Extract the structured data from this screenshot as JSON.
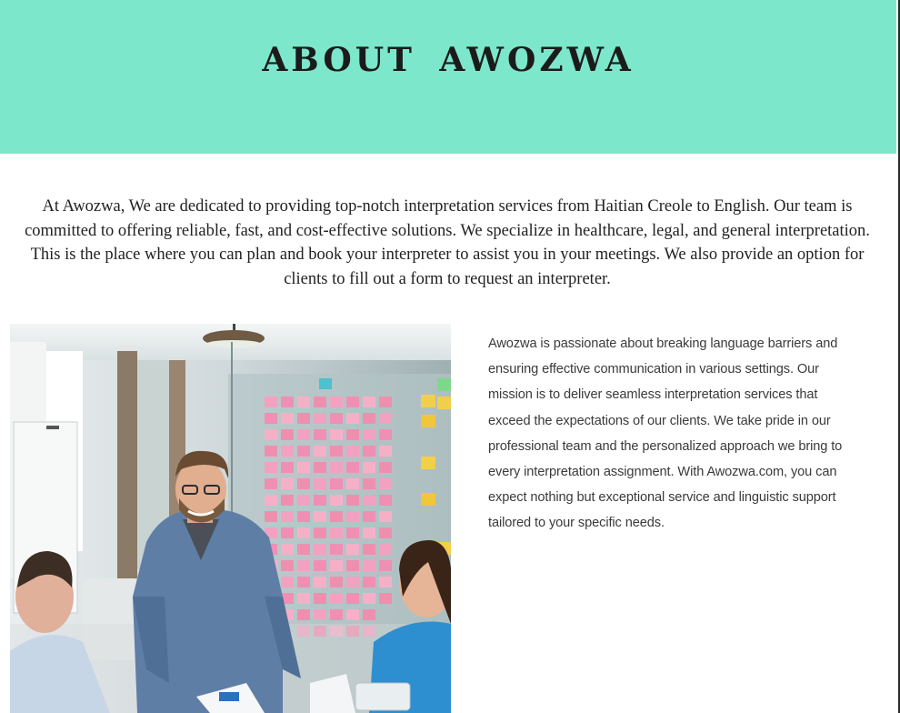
{
  "hero": {
    "title": "ABOUT  AWOZWA",
    "background": "#7de7cc"
  },
  "intro": {
    "text": "At Awozwa, We are dedicated to providing top-notch interpretation services from Haitian Creole to English. Our team is committed to offering reliable, fast, and cost-effective solutions. We specialize in healthcare, legal, and general interpretation. This is the place where you can plan and book your interpreter to assist you in your meetings. We also provide an option for clients to fill out a form to request an interpreter."
  },
  "photo": {
    "subject": "team-meeting-photo"
  },
  "side": {
    "text": "Awozwa is passionate about breaking language barriers and ensuring effective communication in various settings. Our mission is to deliver seamless interpretation services that exceed the expectations of our clients. We take pride in our professional team and the personalized approach we bring to every interpretation assignment. With Awozwa.com, you can expect nothing but exceptional service and linguistic support tailored to your specific needs."
  }
}
